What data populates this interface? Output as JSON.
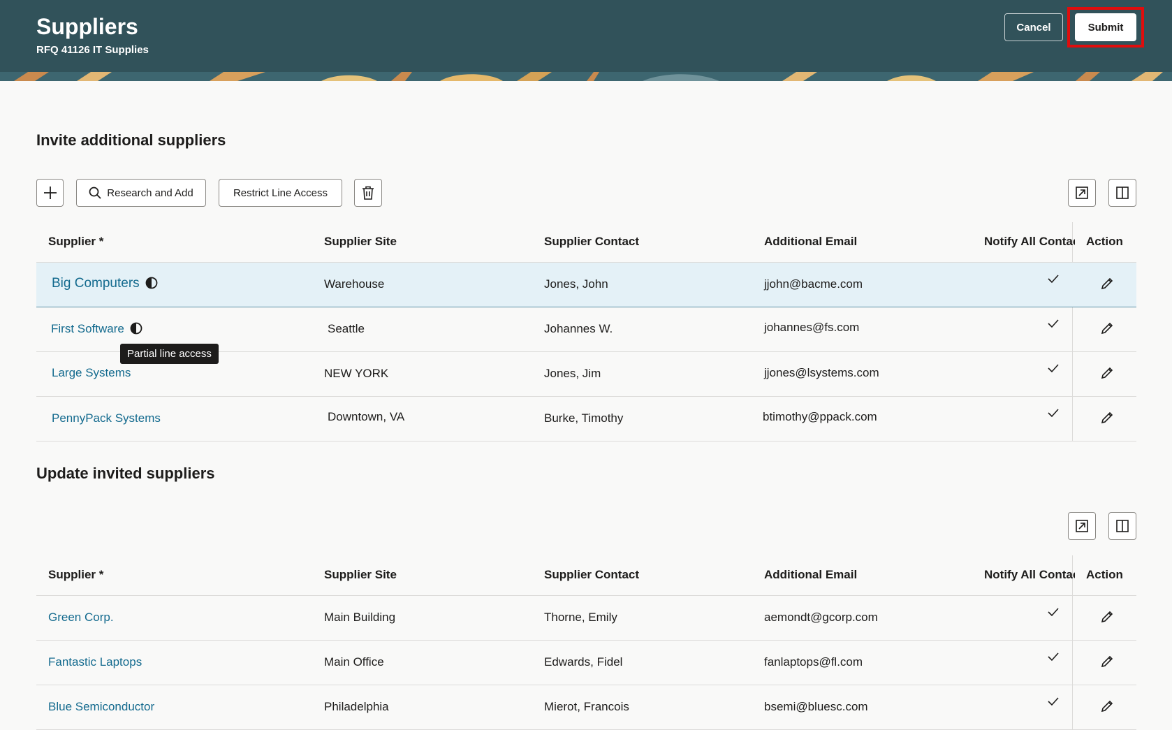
{
  "header": {
    "title": "Suppliers",
    "subtitle": "RFQ 41126 IT Supplies",
    "cancel_label": "Cancel",
    "submit_label": "Submit"
  },
  "invite_section": {
    "title": "Invite additional suppliers",
    "toolbar": {
      "add_icon": "plus-icon",
      "research_label": "Research and Add",
      "restrict_label": "Restrict Line Access",
      "delete_icon": "trash-icon",
      "detach_icon": "detach-icon",
      "columns_icon": "columns-icon"
    },
    "columns": [
      "Supplier *",
      "Supplier Site",
      "Supplier Contact",
      "Additional Email",
      "Notify All Contacts",
      "Action"
    ],
    "rows": [
      {
        "supplier": "Big Computers",
        "site": "Warehouse",
        "contact": "Jones, John",
        "email": "jjohn@bacme.com",
        "notify": true,
        "partial_access": true
      },
      {
        "supplier": "First Software",
        "site": "Seattle",
        "contact": "Johannes W.",
        "email": "johannes@fs.com",
        "notify": true,
        "partial_access": true
      },
      {
        "supplier": "Large Systems",
        "site": "NEW YORK",
        "contact": "Jones, Jim",
        "email": "jjones@lsystems.com",
        "notify": true,
        "partial_access": false
      },
      {
        "supplier": "PennyPack Systems",
        "site": "Downtown, VA",
        "contact": "Burke, Timothy",
        "email": "btimothy@ppack.com",
        "notify": true,
        "partial_access": false
      }
    ],
    "tooltip": "Partial line access"
  },
  "update_section": {
    "title": "Update invited suppliers",
    "columns": [
      "Supplier *",
      "Supplier Site",
      "Supplier Contact",
      "Additional Email",
      "Notify All Contacts",
      "Action"
    ],
    "rows": [
      {
        "supplier": "Green Corp.",
        "site": "Main Building",
        "contact": "Thorne, Emily",
        "email": "aemondt@gcorp.com",
        "notify": true
      },
      {
        "supplier": "Fantastic Laptops",
        "site": "Main Office",
        "contact": "Edwards, Fidel",
        "email": "fanlaptops@fl.com",
        "notify": true
      },
      {
        "supplier": "Blue Semiconductor",
        "site": "Philadelphia",
        "contact": "Mierot, Francois",
        "email": "bsemi@bluesc.com",
        "notify": true
      }
    ]
  },
  "colors": {
    "header_bg": "#31525a",
    "link": "#136a8e",
    "selected_row": "#e4f1f7",
    "highlight": "#e00d0d"
  }
}
